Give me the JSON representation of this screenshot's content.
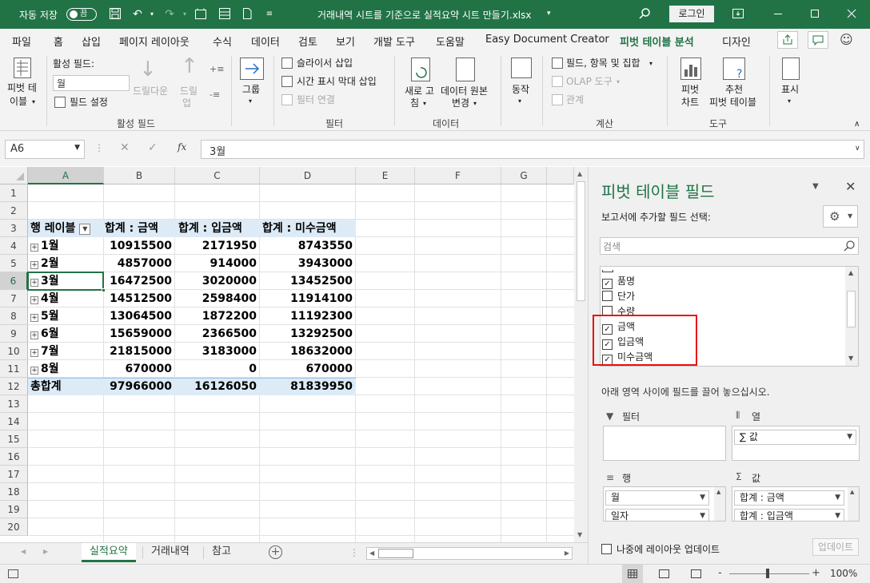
{
  "titlebar": {
    "autosave_label": "자동 저장",
    "autosave_state": "끔",
    "document_title": "거래내역 시트를 기준으로 실적요약 시트 만들기.xlsx",
    "title_dropdown": "▾",
    "login_label": "로그인",
    "bg_color": "#217346"
  },
  "tabs": [
    {
      "label": "파일"
    },
    {
      "label": "홈"
    },
    {
      "label": "삽입"
    },
    {
      "label": "페이지 레이아웃"
    },
    {
      "label": "수식"
    },
    {
      "label": "데이터"
    },
    {
      "label": "검토"
    },
    {
      "label": "보기"
    },
    {
      "label": "개발 도구"
    },
    {
      "label": "도움말"
    },
    {
      "label": "Easy Document Creator"
    },
    {
      "label": "피벗 테이블 분석",
      "active": true
    },
    {
      "label": "디자인"
    }
  ],
  "ribbon": {
    "pivot_table_btn": "피벗 테",
    "pivot_table_btn2": "이블",
    "active_field_label": "활성 필드:",
    "active_field_value": "월",
    "field_settings": "필드 설정",
    "drill_down": "드릴다운",
    "drill_up": "드릴",
    "drill_up2": "업",
    "group_active_field": "활성 필드",
    "group_btn": "그룹",
    "slicer_insert": "슬라이서 삽입",
    "timeline_insert": "시간 표시 막대 삽입",
    "filter_connect": "필터 연결",
    "group_filter": "필터",
    "refresh": "새로 고",
    "refresh2": "침",
    "change_source": "데이터 원본",
    "change_source2": "변경",
    "group_data": "데이터",
    "actions": "동작",
    "fields_items_sets": "필드, 항목 및 집합",
    "olap_tools": "OLAP 도구",
    "relationships": "관계",
    "group_calc": "계산",
    "pivot_chart": "피벗",
    "pivot_chart2": "차트",
    "recommended": "추천",
    "recommended2": "피벗 테이블",
    "group_tools": "도구",
    "show": "표시"
  },
  "formula_bar": {
    "name_box": "A6",
    "fx": "fx",
    "formula_value": "3월"
  },
  "grid": {
    "columns": [
      "A",
      "B",
      "C",
      "D",
      "E",
      "F",
      "G"
    ],
    "selected_column": "A",
    "selected_row": "6",
    "rows": [
      "1",
      "2",
      "3",
      "4",
      "5",
      "6",
      "7",
      "8",
      "9",
      "10",
      "11",
      "12",
      "13",
      "14",
      "15",
      "16",
      "17",
      "18",
      "19",
      "20"
    ],
    "pivot_headers": [
      "행 레이블",
      "합계 : 금액",
      "합계 : 입금액",
      "합계 : 미수금액"
    ],
    "pivot_rows": [
      {
        "label": "1월",
        "amount": "10915500",
        "paid": "2171950",
        "unpaid": "8743550"
      },
      {
        "label": "2월",
        "amount": "4857000",
        "paid": "914000",
        "unpaid": "3943000"
      },
      {
        "label": "3월",
        "amount": "16472500",
        "paid": "3020000",
        "unpaid": "13452500"
      },
      {
        "label": "4월",
        "amount": "14512500",
        "paid": "2598400",
        "unpaid": "11914100"
      },
      {
        "label": "5월",
        "amount": "13064500",
        "paid": "1872200",
        "unpaid": "11192300"
      },
      {
        "label": "6월",
        "amount": "15659000",
        "paid": "2366500",
        "unpaid": "13292500"
      },
      {
        "label": "7월",
        "amount": "21815000",
        "paid": "3183000",
        "unpaid": "18632000"
      },
      {
        "label": "8월",
        "amount": "670000",
        "paid": "0",
        "unpaid": "670000"
      }
    ],
    "grand_total": {
      "label": "총합계",
      "amount": "97966000",
      "paid": "16126050",
      "unpaid": "81839950"
    },
    "header_fill": "#ddebf7"
  },
  "sheet_tabs": [
    {
      "label": "실적요약",
      "active": true
    },
    {
      "label": "거래내역"
    },
    {
      "label": "참고"
    }
  ],
  "pivot_pane": {
    "title": "피벗 테이블 필드",
    "subtitle": "보고서에 추가할 필드 선택:",
    "search_placeholder": "검색",
    "fields": [
      {
        "label": "품명",
        "checked": true
      },
      {
        "label": "단가",
        "checked": false
      },
      {
        "label": "수량",
        "checked": false
      },
      {
        "label": "금액",
        "checked": true
      },
      {
        "label": "입금액",
        "checked": true
      },
      {
        "label": "미수금액",
        "checked": true
      }
    ],
    "drag_hint": "아래 영역 사이에 필드를 끌어 놓으십시오.",
    "area_filter": "필터",
    "area_columns": "열",
    "area_rows": "행",
    "area_values": "값",
    "columns_field": "∑ 값",
    "row_fields": [
      "월",
      "일자"
    ],
    "value_fields": [
      "합계 : 금액",
      "합계 : 입금액"
    ],
    "defer_label": "나중에 레이아웃 업데이트",
    "update_btn": "업데이트",
    "highlight_color": "#e81010"
  },
  "status": {
    "zoom": "100%",
    "zoom_minus": "-",
    "zoom_plus": "+"
  }
}
